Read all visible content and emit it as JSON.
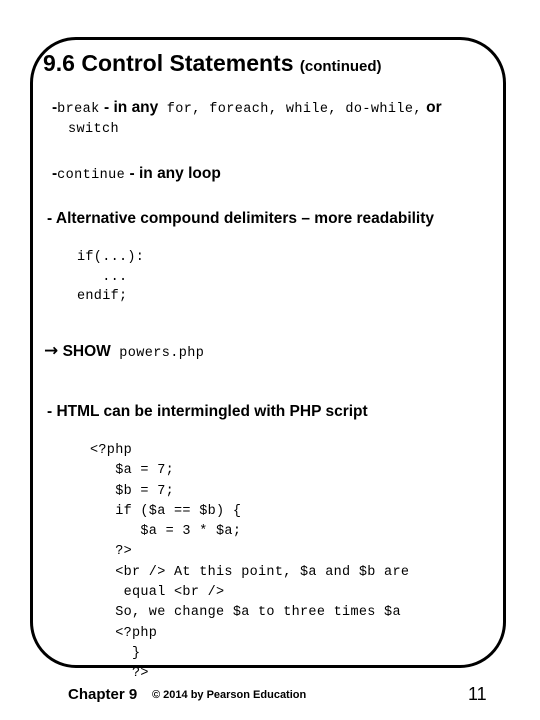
{
  "slide": {
    "title_main": "9.6 Control Statements",
    "title_continued": "(continued)",
    "frame_color": "#000000",
    "background_color": "#ffffff",
    "text_color": "#000000"
  },
  "bullets": {
    "break": {
      "dash": "-",
      "keyword": "break",
      "dash2": "-",
      "emphasis": "in any",
      "code_list": "for, foreach, while, do-while,",
      "conjunction": "or",
      "wrap_code": "switch"
    },
    "continue": {
      "dash": "-",
      "keyword": "continue",
      "dash2": "-",
      "emphasis": "in any loop"
    },
    "alt_delimiters": {
      "text": "- Alternative compound delimiters – more readability"
    },
    "show": {
      "arrow_icon": "rightwards-arrow",
      "arrow": "→",
      "label": "SHOW",
      "file": "powers.php"
    },
    "html_intermingled": {
      "text": "- HTML can be intermingled with PHP script"
    }
  },
  "code_if": {
    "lines": [
      "if(...):",
      "   ...",
      "endif;"
    ],
    "text": "if(...):\n   ...\nendif;"
  },
  "code_php": {
    "lines": [
      "<?php",
      "   $a = 7;",
      "   $b = 7;",
      "   if ($a == $b) {",
      "      $a = 3 * $a;",
      "   ?>",
      "   <br /> At this point, $a and $b are",
      "    equal <br />",
      "   So, we change $a to three times $a",
      "   <?php",
      "     }",
      "     ?>"
    ],
    "text": "<?php\n   $a = 7;\n   $b = 7;\n   if ($a == $b) {\n      $a = 3 * $a;\n   ?>\n   <br /> At this point, $a and $b are\n    equal <br />\n   So, we change $a to three times $a\n   <?php\n     }\n     ?>"
  },
  "footer": {
    "chapter": "Chapter 9",
    "copyright": "© 2014 by Pearson Education",
    "page_number": "11"
  }
}
